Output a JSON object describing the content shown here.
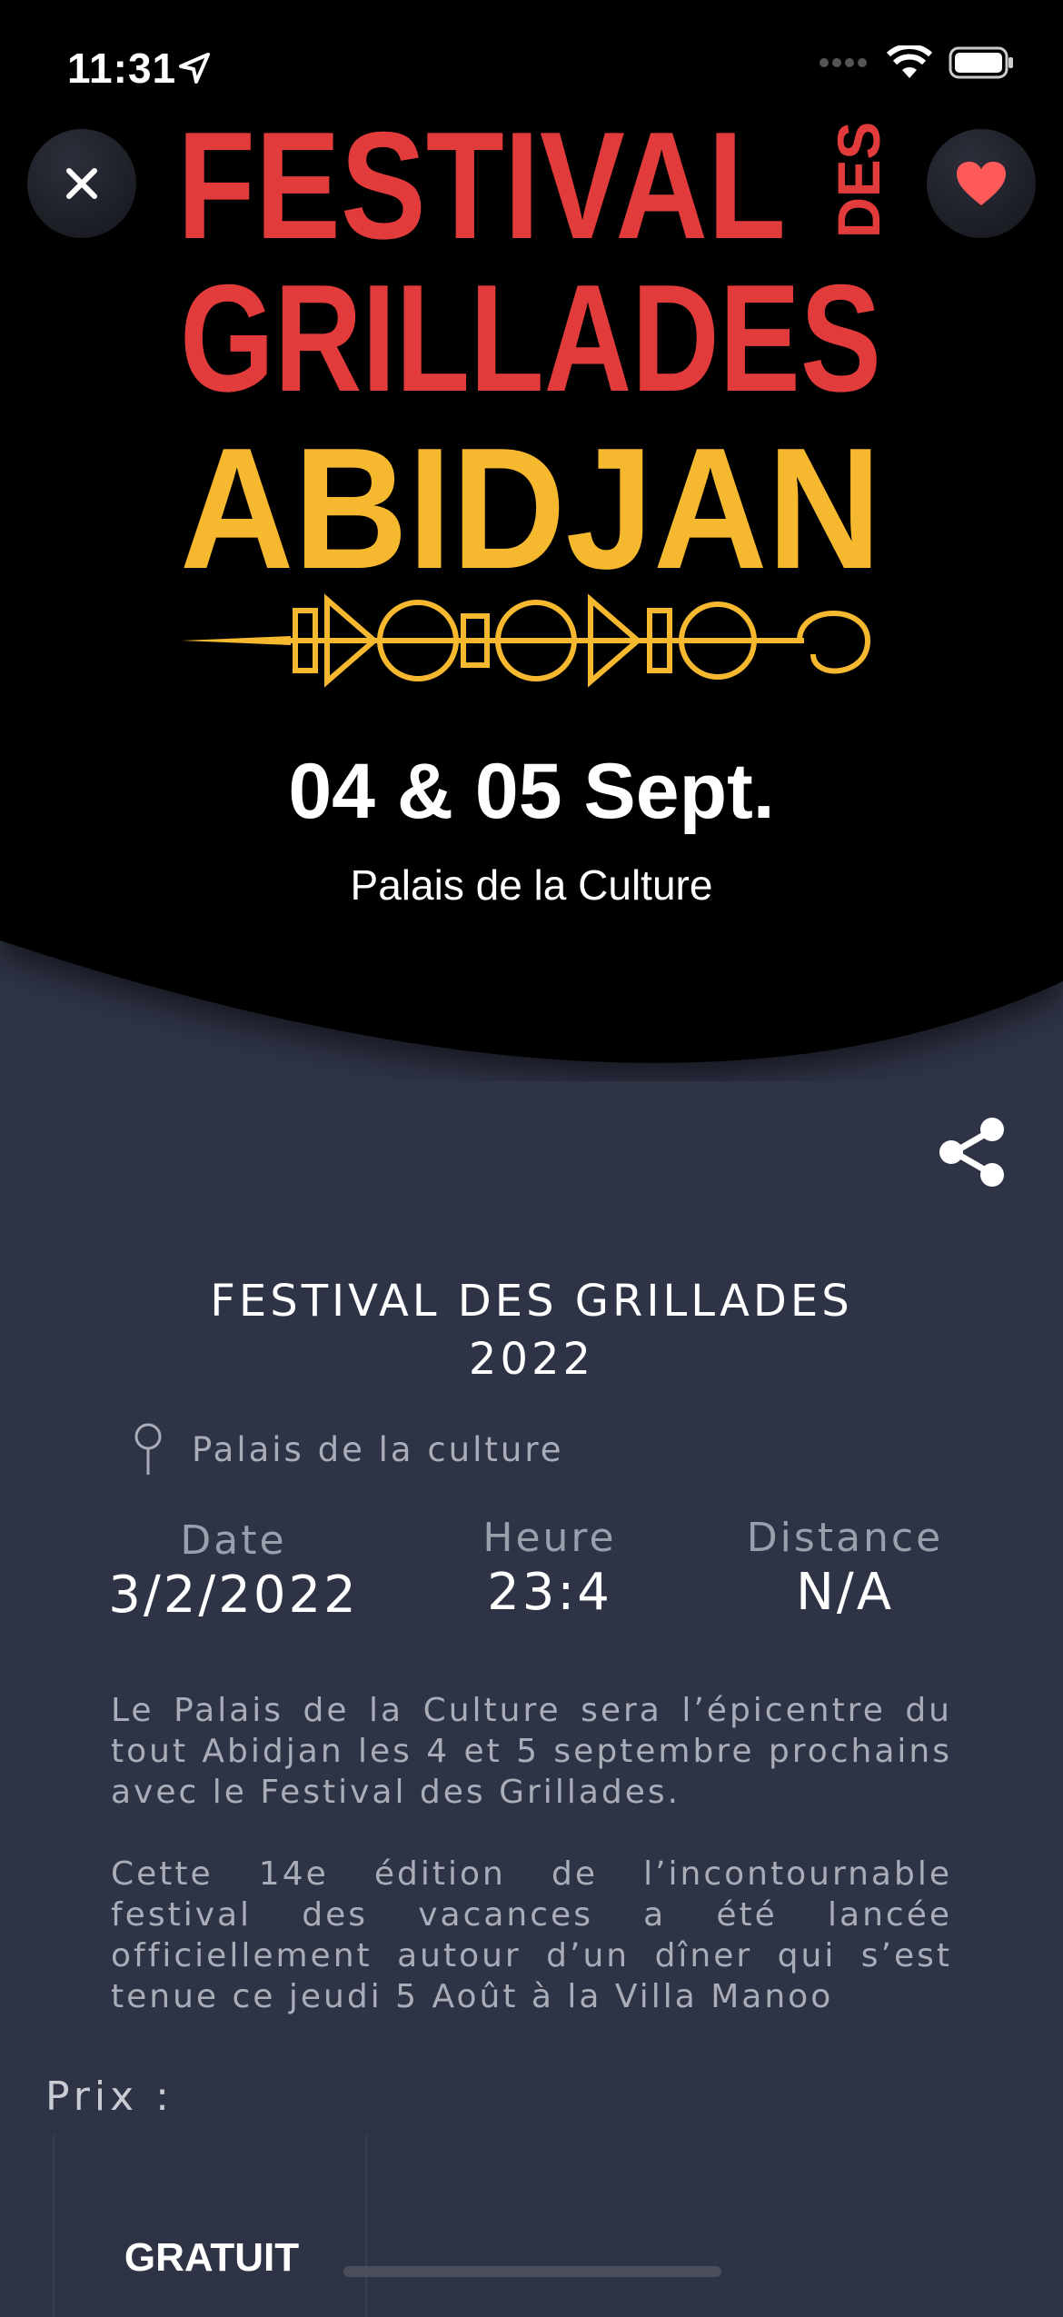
{
  "status_bar": {
    "time": "11:31"
  },
  "poster": {
    "line1": "FESTIVAL",
    "line1_side": "DES",
    "line2": "GRILLADES",
    "line3": "ABIDJAN",
    "dates": "04 & 05 Sept.",
    "venue": "Palais de la Culture"
  },
  "event": {
    "title": "FESTIVAL DES GRILLADES\n2022",
    "location": "Palais de la culture",
    "stats": [
      {
        "label": "Date",
        "value": "3/2/2022"
      },
      {
        "label": "Heure",
        "value": "23:4"
      },
      {
        "label": "Distance",
        "value": "N/A"
      }
    ],
    "description": [
      "Le Palais de la Culture sera l’épicentre du tout Abidjan les 4 et 5 septembre prochains avec le Festival des Grillades.",
      "Cette 14e édition de l’incontournable festival des vacances a été lancée officiellement autour d’un dîner qui s’est tenue ce jeudi 5 Août à la Villa Manoo"
    ],
    "price_label": "Prix :",
    "price_value": "GRATUIT"
  },
  "colors": {
    "background": "#2e3345",
    "poster_red": "#e23b3b",
    "poster_yellow": "#f5b82e",
    "heart": "#ff5a5a"
  },
  "icons": [
    "location-arrow-icon",
    "signal-icon",
    "wifi-icon",
    "battery-icon",
    "close-icon",
    "heart-icon",
    "share-icon",
    "map-pin-icon"
  ]
}
